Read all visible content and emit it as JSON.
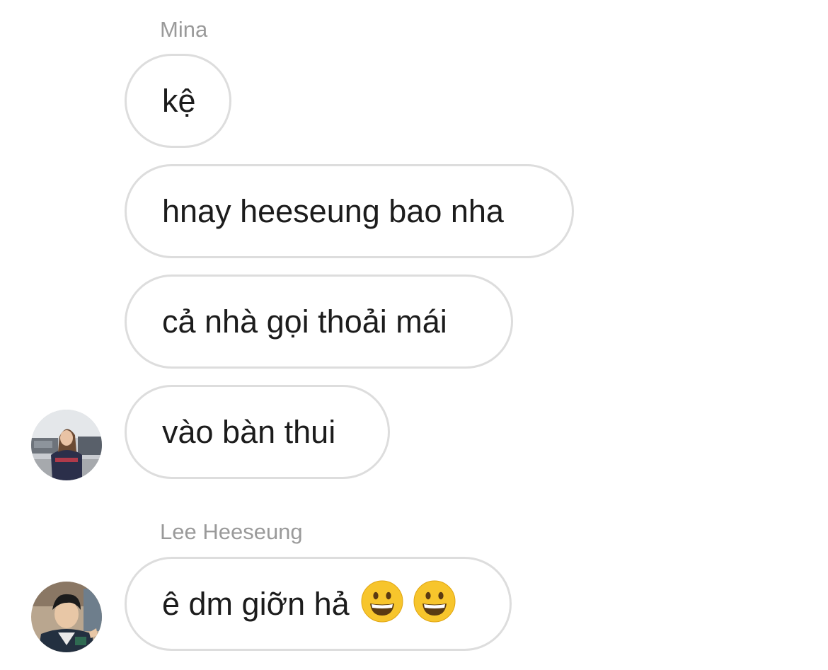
{
  "thread": {
    "groups": [
      {
        "sender": "Mina",
        "messages": [
          "kệ",
          "hnay heeseung bao nha",
          "cả nhà gọi thoải mái",
          "vào bàn thui"
        ]
      },
      {
        "sender": "Lee Heeseung",
        "messages": [
          "ê dm giỡn hả"
        ],
        "emojis": [
          "grinning-face-emoji",
          "grinning-face-emoji"
        ]
      }
    ]
  },
  "colors": {
    "bubble_border": "#dddddd",
    "sender_name": "#9a9a9a",
    "message_text": "#1c1c1c",
    "emoji_yellow": "#f7c52c"
  }
}
